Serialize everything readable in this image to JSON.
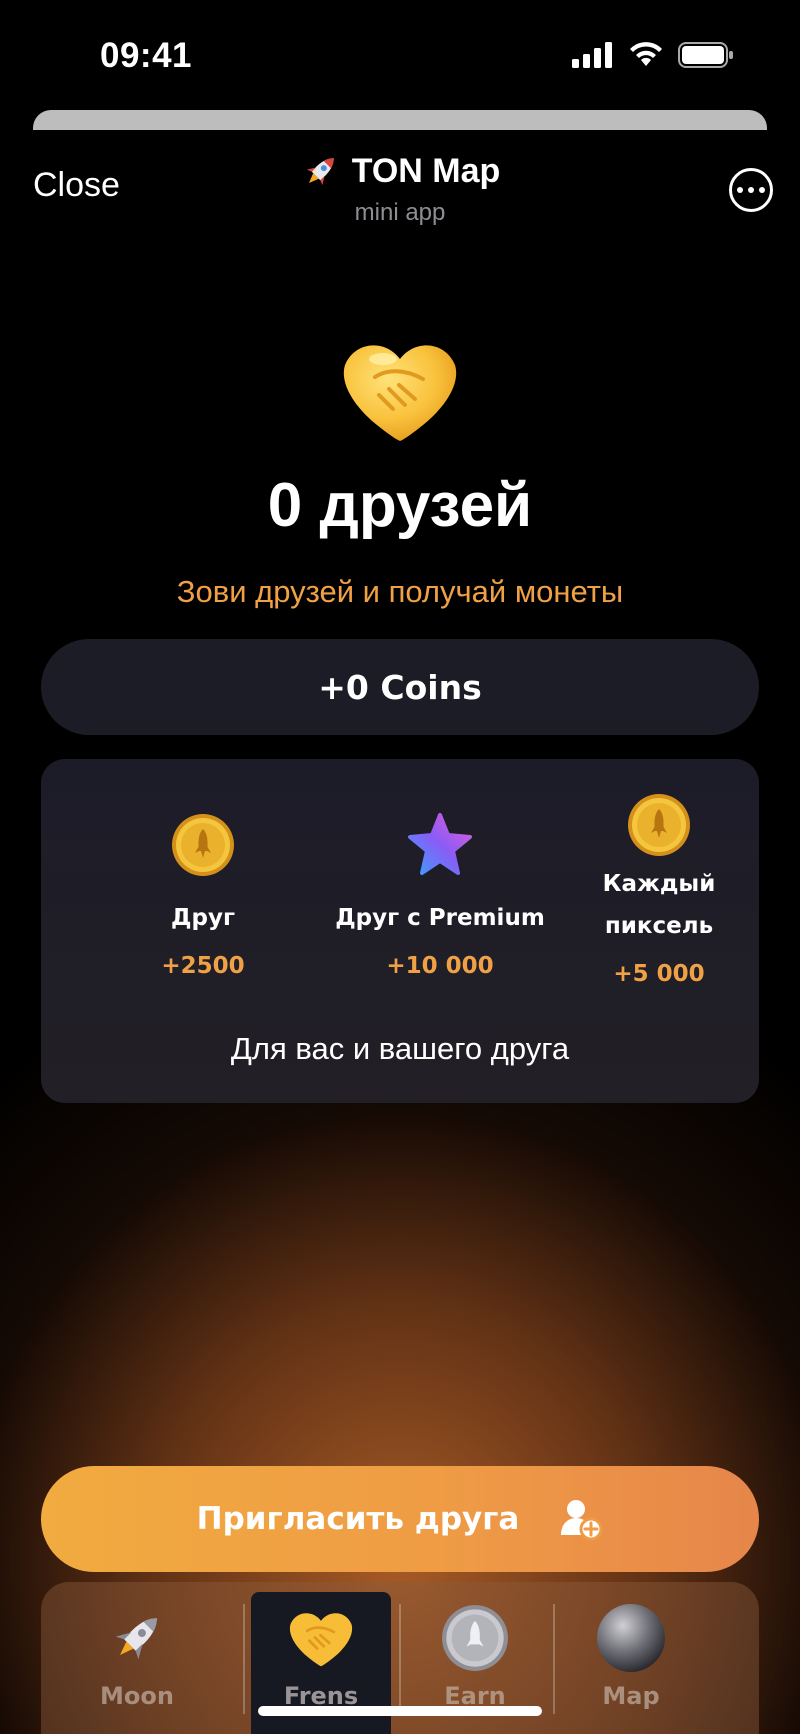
{
  "status_bar": {
    "time": "09:41"
  },
  "header": {
    "close_label": "Close",
    "title": "TON Map",
    "subtitle": "mini app",
    "title_icon": "rocket-icon",
    "more_icon": "more-icon"
  },
  "hero": {
    "icon": "handshake-icon",
    "title": "0 друзей",
    "subtitle": "Зови друзей и получай монеты"
  },
  "coins_pill": {
    "label": "+0 Coins"
  },
  "rewards": {
    "items": [
      {
        "icon": "coin-rocket-icon",
        "label": "Друг",
        "value": "+2500"
      },
      {
        "icon": "premium-star-icon",
        "label": "Друг с Premium",
        "value": "+10 000"
      },
      {
        "icon": "coin-rocket-icon",
        "label_line1": "Каждый",
        "label_line2": "пиксель",
        "value": "+5 000"
      }
    ],
    "footer": "Для вас и вашего друга"
  },
  "invite_button": {
    "label": "Пригласить друга",
    "icon": "add-user-icon"
  },
  "tabs": [
    {
      "label": "Moon",
      "icon": "rocket-icon",
      "active": false
    },
    {
      "label": "Frens",
      "icon": "handshake-icon",
      "active": true
    },
    {
      "label": "Earn",
      "icon": "coin-rocket-icon",
      "active": false
    },
    {
      "label": "Map",
      "icon": "sphere-icon",
      "active": false
    }
  ],
  "colors": {
    "accent_orange": "#f0a146",
    "card_bg": "#1c1c26",
    "background": "#000000",
    "button_gradient_start": "#f1ab3f",
    "button_gradient_end": "#e6864a"
  }
}
